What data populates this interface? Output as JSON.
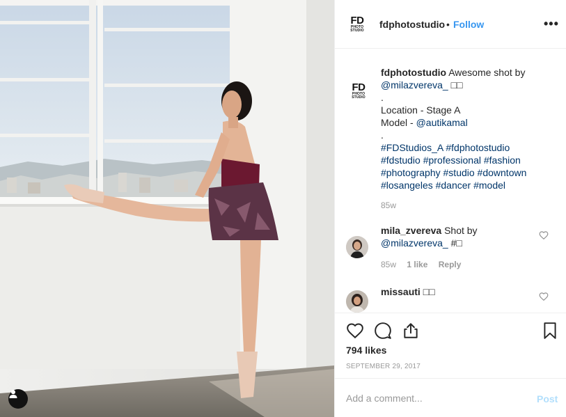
{
  "post": {
    "username": "fdphotostudio",
    "separator": "•",
    "follow_label": "Follow",
    "more_label": "•••",
    "logo_text": "FD",
    "logo_subtext": "PHOTO STUDIO"
  },
  "caption": {
    "username": "fdphotostudio",
    "line1_text": "Awesome shot by",
    "mention1": "@milazvereva_",
    "emoji1": "□□",
    "dot": ".",
    "location_line": "Location - Stage A",
    "model_prefix": "Model - ",
    "model_mention": "@autikamal",
    "hashtags": [
      "#FDStudios_A #fdphotostudio",
      "#fdstudio #professional #fashion",
      "#photography #studio #downtown",
      "#losangeles #dancer #model"
    ],
    "time": "85w"
  },
  "comments": [
    {
      "username": "mila_zvereva",
      "text": "Shot by",
      "mention": "@milazvereva_",
      "tail": "#□",
      "time": "85w",
      "likes": "1 like",
      "reply": "Reply"
    },
    {
      "username": "missauti",
      "text": "□□"
    }
  ],
  "actions": {
    "likes": "794 likes",
    "date": "SEPTEMBER 29, 2017"
  },
  "add_comment": {
    "placeholder": "Add a comment...",
    "post_label": "Post"
  },
  "colors": {
    "accent": "#3897f0",
    "link": "#003569",
    "muted": "#999999",
    "post_disabled": "#b2dffc"
  }
}
